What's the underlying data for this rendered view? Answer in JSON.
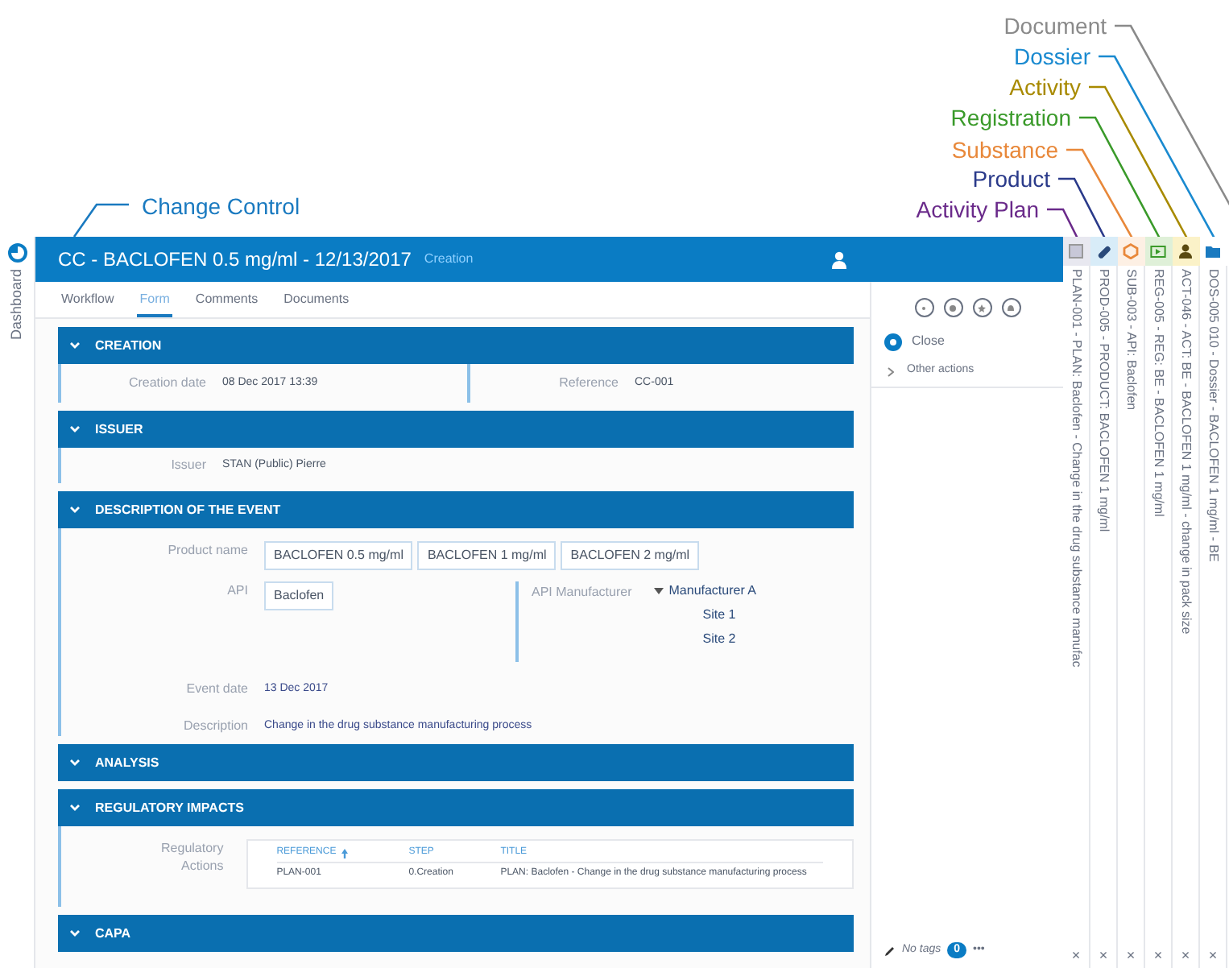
{
  "annotations": [
    {
      "label": "Document",
      "color": "#8a8a8a"
    },
    {
      "label": "Dossier",
      "color": "#1a8ad0"
    },
    {
      "label": "Activity",
      "color": "#a88a00"
    },
    {
      "label": "Registration",
      "color": "#3a9a2a"
    },
    {
      "label": "Substance",
      "color": "#e8883a"
    },
    {
      "label": "Product",
      "color": "#2a3a8a"
    },
    {
      "label": "Activity Plan",
      "color": "#6a2a8a"
    }
  ],
  "header_annotation": "Change Control",
  "sidebar": {
    "label": "Dashboard"
  },
  "header": {
    "title": "CC - BACLOFEN 0.5 mg/ml - 12/13/2017",
    "status": "Creation"
  },
  "tabs": [
    {
      "label": "Workflow",
      "selected": false
    },
    {
      "label": "Form",
      "selected": true
    },
    {
      "label": "Comments",
      "selected": false
    },
    {
      "label": "Documents",
      "selected": false
    }
  ],
  "sections": [
    {
      "kind": "split",
      "title": "CREATION",
      "left": {
        "label": "Creation date",
        "value": "08 Dec 2017 13:39"
      },
      "right": {
        "label": "Reference",
        "value": "CC-001"
      }
    },
    {
      "kind": "fields",
      "title": "ISSUER",
      "fields": [
        {
          "label": "Issuer",
          "value": "STAN (Public) Pierre"
        }
      ]
    },
    {
      "kind": "event",
      "title": "DESCRIPTION OF THE EVENT",
      "product": {
        "label": "Product name",
        "chips": [
          "BACLOFEN 0.5 mg/ml",
          "BACLOFEN 1 mg/ml",
          "BACLOFEN 2 mg/ml"
        ]
      },
      "api": {
        "label": "API",
        "chips": [
          "Baclofen"
        ]
      },
      "manufacturer": {
        "label": "API Manufacturer",
        "tree": [
          {
            "label": "Manufacturer A",
            "expanded": true,
            "children": [
              {
                "label": "Site 1"
              },
              {
                "label": "Site 2"
              }
            ]
          }
        ]
      },
      "fields": [
        {
          "label": "Event date",
          "value": "13 Dec 2017"
        },
        {
          "label": "Description",
          "value": "Change in the drug substance manufacturing process"
        }
      ]
    },
    {
      "kind": "empty",
      "title": "ANALYSIS"
    },
    {
      "kind": "table",
      "title": "REGULATORY IMPACTS",
      "label": "Regulatory Actions",
      "columns": [
        {
          "label": "REFERENCE",
          "sorted": true
        },
        {
          "label": "STEP",
          "sorted": false
        },
        {
          "label": "TITLE",
          "sorted": false
        }
      ],
      "rows": [
        [
          "PLAN-001",
          "0.Creation",
          "PLAN: Baclofen - Change in the drug substance manufacturing process"
        ]
      ]
    },
    {
      "kind": "empty",
      "title": "CAPA"
    }
  ],
  "actions": {
    "primary": "Close",
    "more": "Other actions"
  },
  "tags": {
    "label": "No tags",
    "count": "0",
    "more": "•••"
  },
  "linked_objects": [
    {
      "kind": "plan",
      "text": "PLAN-001 - PLAN: Baclofen - Change in the drug substance manufac",
      "close": "×"
    },
    {
      "kind": "product",
      "text": "PROD-005 - PRODUCT: BACLOFEN 1 mg/ml",
      "close": "×"
    },
    {
      "kind": "substance",
      "text": "SUB-003 - API: Baclofen",
      "close": "×"
    },
    {
      "kind": "registration",
      "text": "REG-005 - REG: BE - BACLOFEN 1 mg/ml",
      "close": "×"
    },
    {
      "kind": "activity",
      "text": "ACT-046 - ACT: BE - BACLOFEN 1 mg/ml - change in pack size",
      "close": "×"
    },
    {
      "kind": "dossier",
      "text": "DOS-005 010 - Dossier - BACLOFEN 1 mg/ml - BE",
      "close": "×"
    }
  ]
}
